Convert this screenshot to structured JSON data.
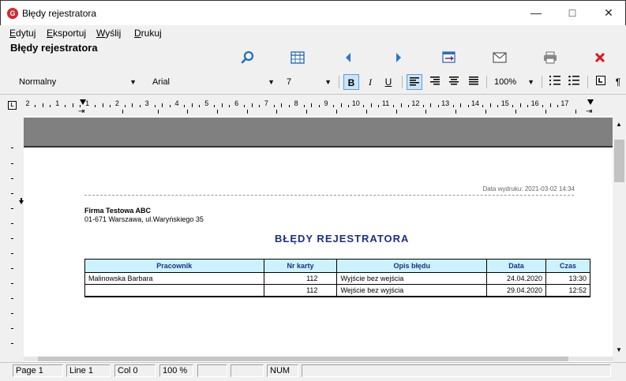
{
  "window": {
    "title": "Błędy rejestratora"
  },
  "menu": [
    {
      "underline": "E",
      "rest": "dytuj"
    },
    {
      "underline": "E",
      "rest": "ksportuj"
    },
    {
      "underline": "W",
      "rest": "yślij"
    },
    {
      "underline": "D",
      "rest": "rukuj"
    }
  ],
  "heading": "Błędy rejestratora",
  "toolbar_icons": [
    "search-icon",
    "table-icon",
    "prev-page-icon",
    "next-page-icon",
    "export-icon",
    "mail-icon",
    "print-icon",
    "close-icon"
  ],
  "format": {
    "style": "Normalny",
    "font": "Arial",
    "size": "7",
    "zoom": "100%",
    "bold": "B",
    "italic": "I",
    "underline": "U"
  },
  "ruler": {
    "numbers": [
      "2",
      "1",
      "1",
      "2",
      "3",
      "4",
      "5",
      "6",
      "7",
      "8",
      "9",
      "10",
      "11",
      "12",
      "13",
      "14",
      "15",
      "16",
      "17"
    ]
  },
  "report": {
    "print_date": "Data wydruku: 2021-03-02  14:34",
    "company_name": "Firma Testowa ABC",
    "company_address": "01-671 Warszawa, ul.Waryńskiego 35",
    "title": "BŁĘDY  REJESTRATORA",
    "columns": [
      "Pracownik",
      "Nr karty",
      "Opis błędu",
      "Data",
      "Czas"
    ],
    "rows": [
      [
        "Malinowska Barbara",
        "112",
        "Wyjście bez wejścia",
        "24.04.2020",
        "13:30"
      ],
      [
        "",
        "112",
        "Wejście bez wyjścia",
        "29.04.2020",
        "12:52"
      ]
    ]
  },
  "status": {
    "page": "Page   1",
    "line": "Line   1",
    "col": "Col   0",
    "zoom": "100 %",
    "num": "NUM"
  }
}
